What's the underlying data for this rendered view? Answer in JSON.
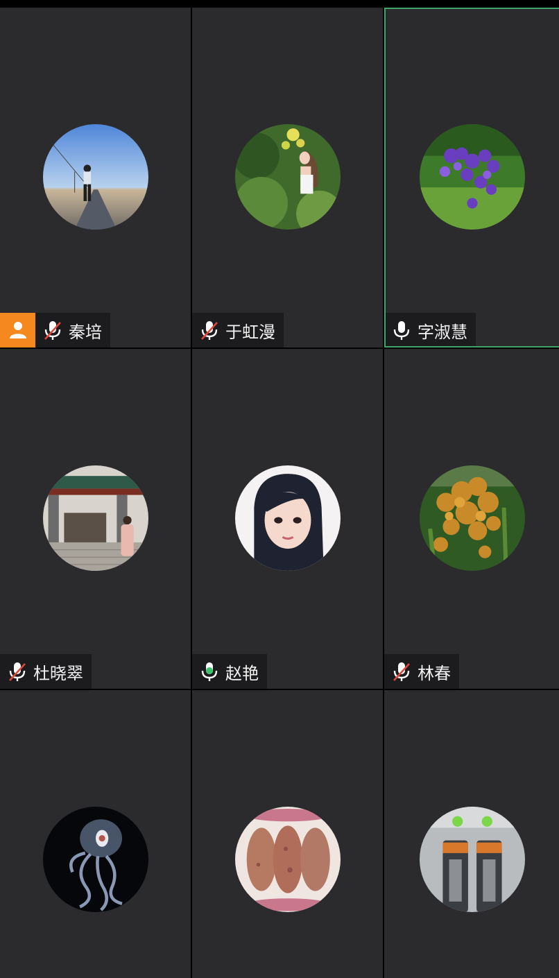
{
  "participants": [
    {
      "name": "秦培",
      "mic": "muted",
      "host": true,
      "active": false,
      "avatar": "woman-on-road-photo-icon"
    },
    {
      "name": "于虹漫",
      "mic": "muted",
      "host": false,
      "active": false,
      "avatar": "girl-with-leaves-illustration-icon"
    },
    {
      "name": "字淑慧",
      "mic": "on",
      "host": false,
      "active": true,
      "avatar": "purple-flowers-photo-icon"
    },
    {
      "name": "杜晓翠",
      "mic": "muted",
      "host": false,
      "active": false,
      "avatar": "woman-at-gate-photo-icon"
    },
    {
      "name": "赵艳",
      "mic": "speaking",
      "host": false,
      "active": false,
      "avatar": "anime-girl-portrait-icon"
    },
    {
      "name": "林春",
      "mic": "muted",
      "host": false,
      "active": false,
      "avatar": "millet-plant-photo-icon"
    },
    {
      "avatar": "jellyfish-photo-icon"
    },
    {
      "avatar": "sweet-potatoes-photo-icon"
    },
    {
      "avatar": "batteries-photo-icon"
    }
  ],
  "colors": {
    "tile_bg": "#2b2b2e",
    "nameplate_bg": "#1c1c1e",
    "host_badge": "#f5891f",
    "active_border": "#3fa66a",
    "mic_speaking": "#3cc46a",
    "mic_muted_slash": "#e0473c"
  }
}
